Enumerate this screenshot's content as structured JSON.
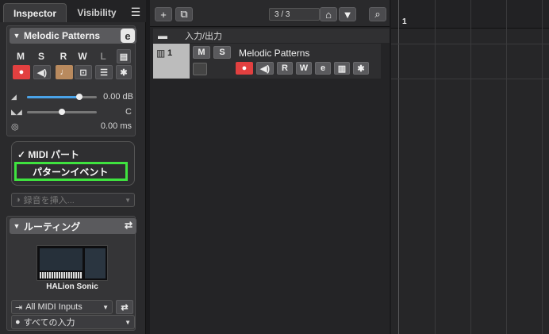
{
  "inspector": {
    "tab_active": "Inspector",
    "tab_inactive": "Visibility",
    "tab_menu_icon": "hamburger-icon",
    "track_section": {
      "title": "Melodic Patterns",
      "edit_icon": "e",
      "buttons_row1": [
        "M",
        "S",
        "R",
        "W",
        "L"
      ],
      "volume_value": "0.00 dB",
      "pan_value": "C",
      "delay_value": "0.00 ms"
    },
    "menu": {
      "item_checked": "MIDI パート",
      "item_highlighted": "パターンイベント"
    },
    "insert_placeholder": "録音を挿入...",
    "routing": {
      "title": "ルーティング",
      "plugin_name": "HALion Sonic",
      "input": "All MIDI Inputs",
      "channel": "すべての入力"
    },
    "slider_levels": {
      "volume_percent": 75,
      "pan_percent": 50
    }
  },
  "tracklist": {
    "counter": "3 / 3",
    "folder_label": "入力/出力",
    "track": {
      "number": "1",
      "name": "Melodic Patterns",
      "buttons": [
        "M",
        "S"
      ],
      "buttons_row2": [
        "R",
        "W"
      ]
    }
  },
  "timeline": {
    "bar_number": "1"
  },
  "colors": {
    "accent_green": "#3fe33f",
    "record_red": "#e24040",
    "slider_blue": "#4aa3e8"
  }
}
